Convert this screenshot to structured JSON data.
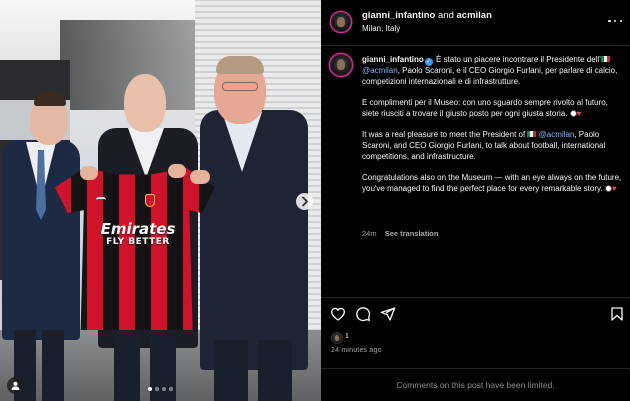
{
  "header": {
    "author": "gianni_infantino",
    "conjunction": "and",
    "coauthor": "acmilan",
    "location": "Milan, Italy"
  },
  "caption": {
    "username": "gianni_infantino",
    "p1_a": " È stato un piacere incontrare il Presidente dell'",
    "p1_mention": "@acmilan",
    "p1_b": ", Paolo Scaroni, e il CEO Giorgio Furlani, per parlare di calcio, competizioni internazionali e di infrastrutture.",
    "p2": "E complimenti per il Museo: con uno sguardo sempre rivolto al futuro, siete riusciti a trovare il giusto posto per ogni giusta storia. ",
    "p3_a": "It was a real pleasure to meet the President of ",
    "p3_mention": "@acmilan",
    "p3_b": ", Paolo Scaroni, and CEO Giorgio Furlani, to talk about football, international competitions, and infrastructure.",
    "p4": "Congratulations also on the Museum — with an eye always on the future, you've managed to find the perfect place for every remarkable story. ",
    "age": "24m",
    "translate": "See translation"
  },
  "photo": {
    "jersey_sponsor": "Emirates",
    "jersey_tagline": "FLY BETTER",
    "slide_count": 4,
    "active_slide": 1
  },
  "footer": {
    "likes": "1",
    "timestamp": "24 minutes ago",
    "comments_notice": "Comments on this post have been limited."
  },
  "icons": {
    "like": "heart-icon",
    "comment": "comment-icon",
    "share": "share-icon",
    "save": "bookmark-icon",
    "next": "chevron-right-icon",
    "more": "more-options-icon",
    "tagged": "user-tag-icon"
  },
  "colors": {
    "background": "#000000",
    "mention": "#8ab4f8",
    "verified": "#3897f0",
    "muted": "#a8a8a8",
    "milan_red": "#d0122a"
  }
}
